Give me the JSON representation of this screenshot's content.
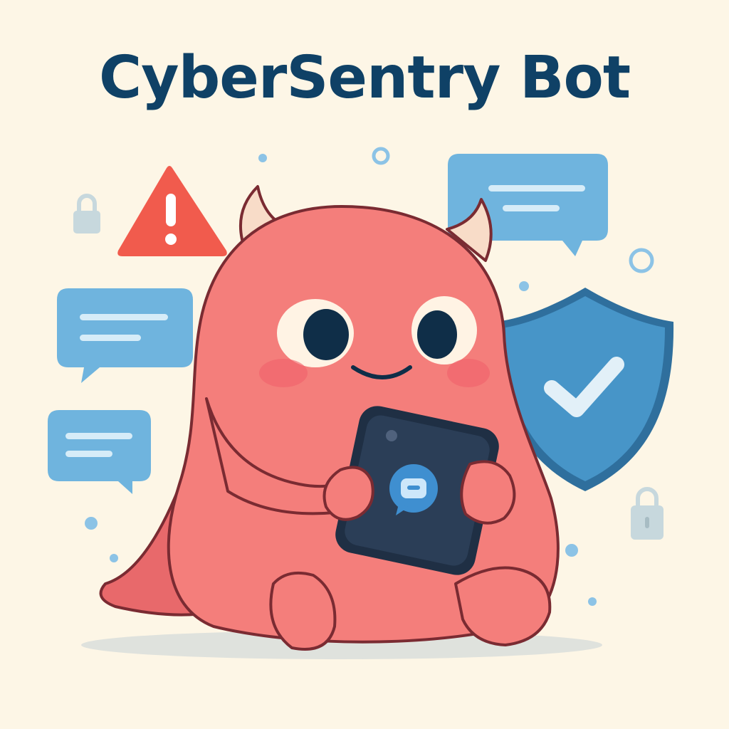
{
  "header": {
    "title": "CyberSentry Bot"
  },
  "colors": {
    "background": "#fdf6e6",
    "title": "#0f4166",
    "monster": "#f47e7b",
    "outline": "#7a2b32",
    "bubble": "#6fb4de",
    "shield": "#3b8dc0",
    "warning": "#f15b4d"
  },
  "icons": [
    "warning-icon",
    "padlock-icon",
    "speech-bubble-icon",
    "shield-check-icon",
    "smartphone-icon",
    "chat-icon"
  ]
}
